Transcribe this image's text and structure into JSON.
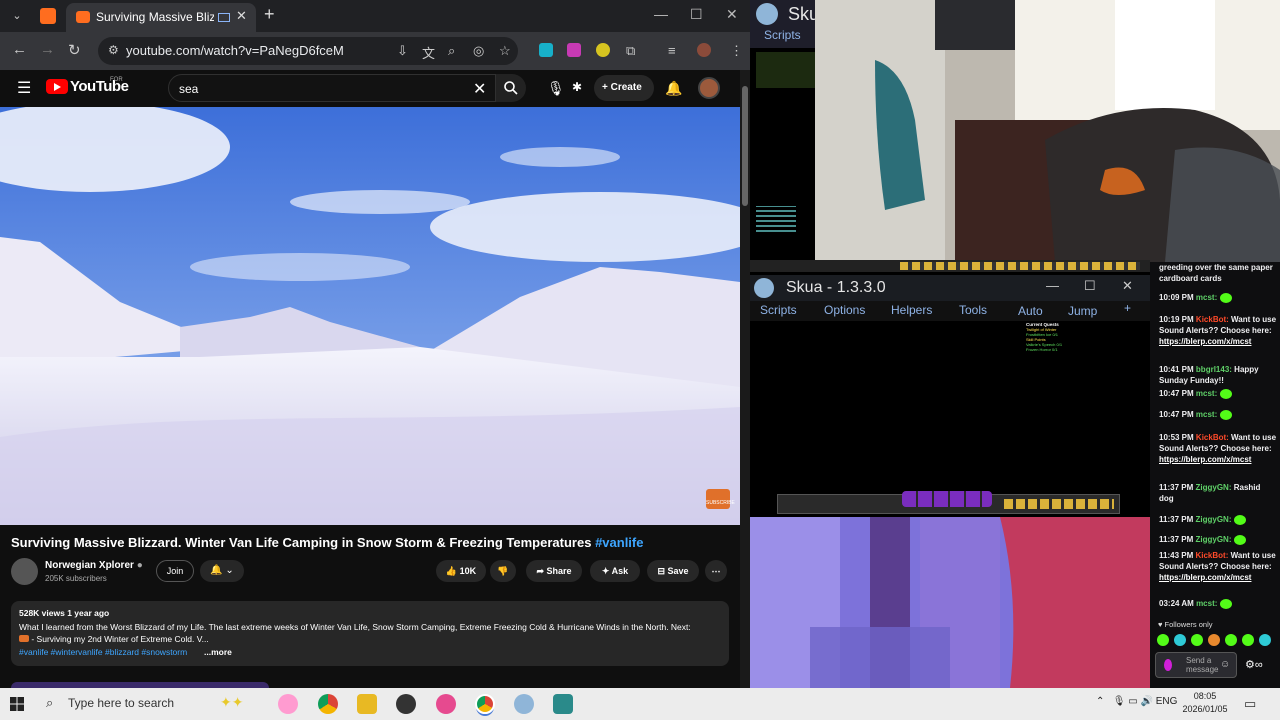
{
  "browser": {
    "tab_title": "Surviving Massive Blizzard.",
    "url": "youtube.com/watch?v=PaNegD6fceM"
  },
  "youtube": {
    "logo_text": "YouTube",
    "logo_region": "FOR",
    "search_value": "sea",
    "create_label": "Create",
    "video_title": "Surviving Massive Blizzard. Winter Van Life Camping in Snow Storm & Freezing Temperatures",
    "video_hashtag": "#vanlife",
    "channel_name": "Norwegian Xplorer",
    "subscribers": "205K subscribers",
    "join_label": "Join",
    "likes": "10K",
    "share_label": "Share",
    "ask_label": "Ask",
    "save_label": "Save",
    "meta": "528K views  1 year ago",
    "desc_line1": "What I learned from the Worst Blizzard of my Life. The last extreme weeks of Winter Van Life, Snow Storm Camping, Extreme Freezing Cold & Hurricane Winds in the North. Next:",
    "desc_line2": " - Surviving my 2nd Winter of Extreme Cold. V...",
    "desc_tags": "#vanlife #wintervanlife #blizzard #snowstorm",
    "more_label": "...more",
    "subscribe_watermark": "SUBSCRIBE"
  },
  "skua_top": {
    "title": "Sku",
    "menu": "Scripts"
  },
  "skua": {
    "title": "Skua - 1.3.3.0",
    "menu": [
      "Scripts",
      "Options",
      "Helpers",
      "Tools",
      "Auto",
      "Jump",
      "+"
    ],
    "quest_title": "Current Quests",
    "quest_lines": [
      "Twilight of Winter",
      "Frostbitten Ice 0/1",
      "Skill Points",
      "Valkrie's Speech 0/1",
      "Frozen Horror 0/1"
    ]
  },
  "chat": {
    "top_text": "greeding over the same paper cardboard cards",
    "messages": [
      {
        "time": "10:09 PM",
        "user": "mcst:",
        "text": ""
      },
      {
        "time": "10:19 PM",
        "user": "KickBot:",
        "text": "Want to use Sound Alerts?? Choose here:",
        "link": "https://blerp.com/x/mcst"
      },
      {
        "time": "10:41 PM",
        "user": "bbgrl143:",
        "text": "Happy Sunday Funday!!"
      },
      {
        "time": "10:47 PM",
        "user": "mcst:",
        "text": ""
      },
      {
        "time": "10:47 PM",
        "user": "mcst:",
        "text": ""
      },
      {
        "time": "10:53 PM",
        "user": "KickBot:",
        "text": "Want to use Sound Alerts?? Choose here:",
        "link": "https://blerp.com/x/mcst"
      },
      {
        "time": "11:37 PM",
        "user": "ZiggyGN:",
        "text": "Rashid dog"
      },
      {
        "time": "11:37 PM",
        "user": "ZiggyGN:",
        "text": ""
      },
      {
        "time": "11:37 PM",
        "user": "ZiggyGN:",
        "text": ""
      },
      {
        "time": "11:43 PM",
        "user": "KickBot:",
        "text": "Want to use Sound Alerts?? Choose here:",
        "link": "https://blerp.com/x/mcst"
      },
      {
        "time": "03:24 AM",
        "user": "mcst:",
        "text": ""
      }
    ],
    "followers_only": "Followers only",
    "input_placeholder": "Send a message"
  },
  "taskbar": {
    "search_placeholder": "Type here to search",
    "language": "ENG",
    "time": "08:05",
    "date": "2026/01/05"
  },
  "colors": {
    "youtube_red": "#ff0000",
    "link_blue": "#3ea6ff",
    "kick_green": "#53fc18",
    "taskbar": "#ececec"
  }
}
